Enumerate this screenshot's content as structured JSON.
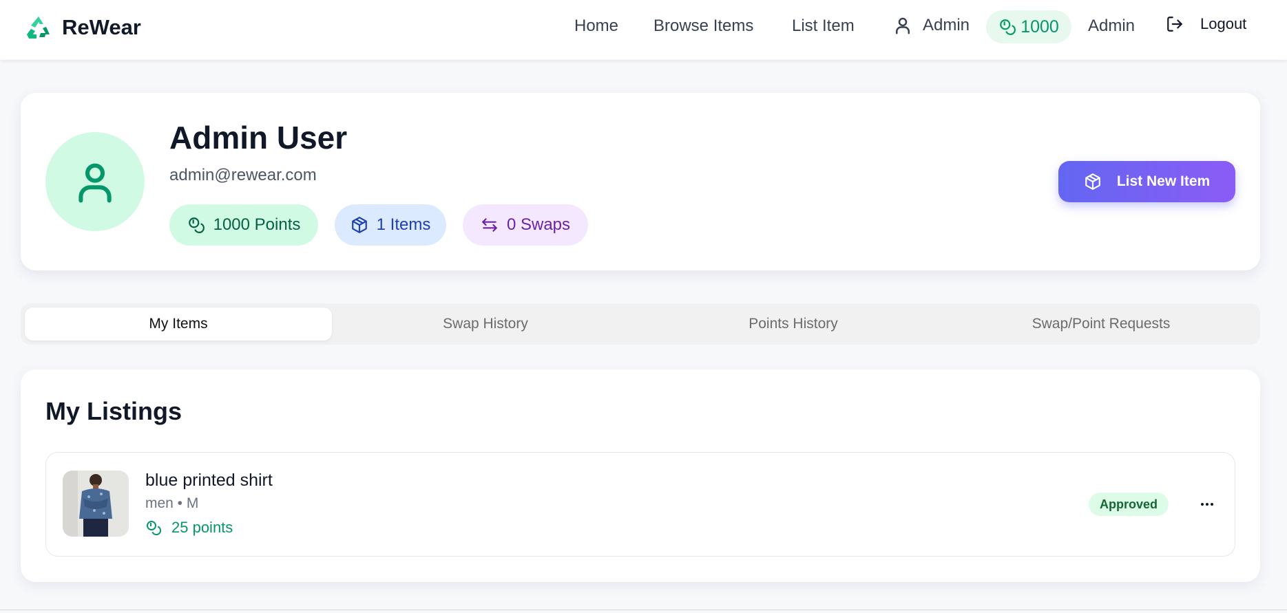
{
  "header": {
    "brand": "ReWear",
    "nav": {
      "home": "Home",
      "browse": "Browse Items",
      "list_item": "List Item",
      "user_label": "Admin",
      "points": "1000",
      "admin": "Admin",
      "logout": "Logout"
    }
  },
  "profile": {
    "name": "Admin User",
    "email": "admin@rewear.com",
    "points_label": "1000 Points",
    "items_label": "1 Items",
    "swaps_label": "0 Swaps",
    "list_button": "List New Item"
  },
  "tabs": [
    {
      "label": "My Items",
      "active": true
    },
    {
      "label": "Swap History",
      "active": false
    },
    {
      "label": "Points History",
      "active": false
    },
    {
      "label": "Swap/Point Requests",
      "active": false
    }
  ],
  "listings": {
    "title": "My Listings",
    "items": [
      {
        "name": "blue printed shirt",
        "meta": "men • M",
        "points": "25 points",
        "status": "Approved"
      }
    ]
  },
  "colors": {
    "accent_green": "#059669",
    "button_gradient_start": "#6366f1",
    "button_gradient_end": "#8b5cf6"
  },
  "icons": [
    "recycle-logo-icon",
    "user-icon",
    "coins-icon",
    "logout-icon",
    "package-icon",
    "swap-arrows-icon",
    "more-horizontal-icon"
  ]
}
